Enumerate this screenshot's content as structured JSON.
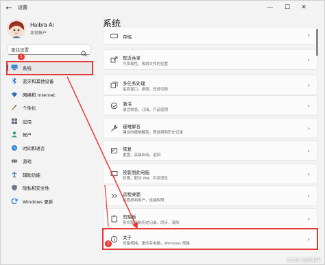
{
  "app": {
    "title": "设置",
    "back_icon": "back-arrow-icon",
    "controls": {
      "minimize": "—",
      "maximize": "☐",
      "close": "✕"
    }
  },
  "profile": {
    "name": "Haibra Ai",
    "account_type": "本地帐户"
  },
  "search": {
    "placeholder": "查找设置"
  },
  "sidebar": {
    "items": [
      {
        "label": "系统",
        "icon": "monitor-icon",
        "active": true
      },
      {
        "label": "蓝牙和其他设备",
        "icon": "bluetooth-icon"
      },
      {
        "label": "网络和 Internet",
        "icon": "network-icon"
      },
      {
        "label": "个性化",
        "icon": "brush-icon"
      },
      {
        "label": "应用",
        "icon": "apps-icon"
      },
      {
        "label": "帐户",
        "icon": "account-icon"
      },
      {
        "label": "时间和语言",
        "icon": "globe-clock-icon"
      },
      {
        "label": "游戏",
        "icon": "gamepad-icon"
      },
      {
        "label": "辅助功能",
        "icon": "accessibility-icon"
      },
      {
        "label": "隐私和安全性",
        "icon": "shield-icon"
      },
      {
        "label": "Windows 更新",
        "icon": "update-icon"
      }
    ]
  },
  "main": {
    "title": "系统",
    "cards": [
      {
        "title": "存储",
        "subtitle": "",
        "icon": "storage-icon"
      },
      {
        "title": "就近共享",
        "subtitle": "可发现性，收到文件的位置",
        "icon": "share-icon"
      },
      {
        "title": "多任务处理",
        "subtitle": "贴靠窗口，桌面，任务切换",
        "icon": "multitask-icon"
      },
      {
        "title": "激活",
        "subtitle": "激活状态，订阅，产品密钥",
        "icon": "activation-icon"
      },
      {
        "title": "疑难解答",
        "subtitle": "建议的疑难解答，首选项和历史记录",
        "icon": "wrench-icon"
      },
      {
        "title": "恢复",
        "subtitle": "重置，高级启动，返回",
        "icon": "recovery-icon"
      },
      {
        "title": "投影到此电脑",
        "subtitle": "权限，配对 PIN，可发现性",
        "icon": "projector-icon"
      },
      {
        "title": "远程桌面",
        "subtitle": "远程桌面用户，连接权限",
        "icon": "remote-icon"
      },
      {
        "title": "剪贴板",
        "subtitle": "剪切和复制历史记录，同步，清除",
        "icon": "clipboard-icon"
      },
      {
        "title": "关于",
        "subtitle": "设备规格，重命名电脑，Windows 规格",
        "icon": "info-icon"
      }
    ]
  },
  "annotations": {
    "badge1": "1",
    "badge2": "2",
    "color": "#e53935"
  },
  "watermark": "CSDN @高电平"
}
